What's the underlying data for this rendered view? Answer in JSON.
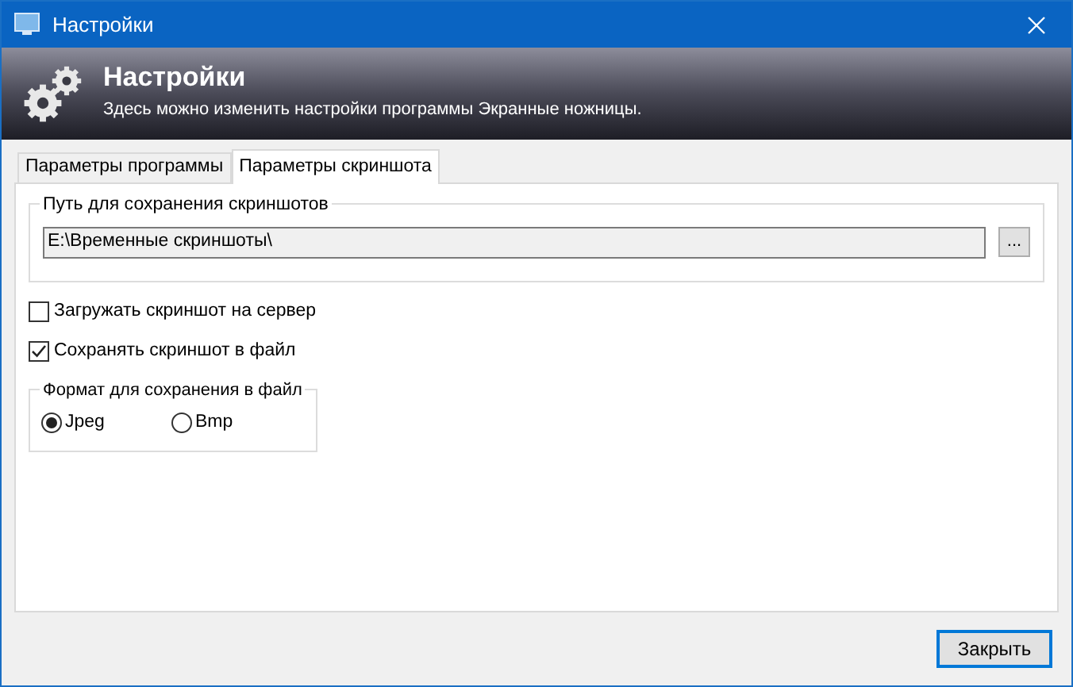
{
  "window": {
    "title": "Настройки"
  },
  "header": {
    "title": "Настройки",
    "subtitle": "Здесь можно изменить настройки программы Экранные ножницы."
  },
  "tabs": [
    {
      "label": "Параметры программы",
      "selected": false
    },
    {
      "label": "Параметры скриншота",
      "selected": true
    }
  ],
  "path_group": {
    "title": "Путь для сохранения скриншотов",
    "value": "E:\\Временные скриншоты\\",
    "browse_button": "..."
  },
  "checkboxes": [
    {
      "label": "Загружать скриншот на сервер",
      "checked": false
    },
    {
      "label": "Сохранять скриншот в файл",
      "checked": true
    }
  ],
  "format_group": {
    "title": "Формат для сохранения в файл",
    "options": [
      {
        "label": "Jpeg",
        "selected": true
      },
      {
        "label": "Bmp",
        "selected": false
      }
    ]
  },
  "buttons": [
    "Закрыть"
  ]
}
